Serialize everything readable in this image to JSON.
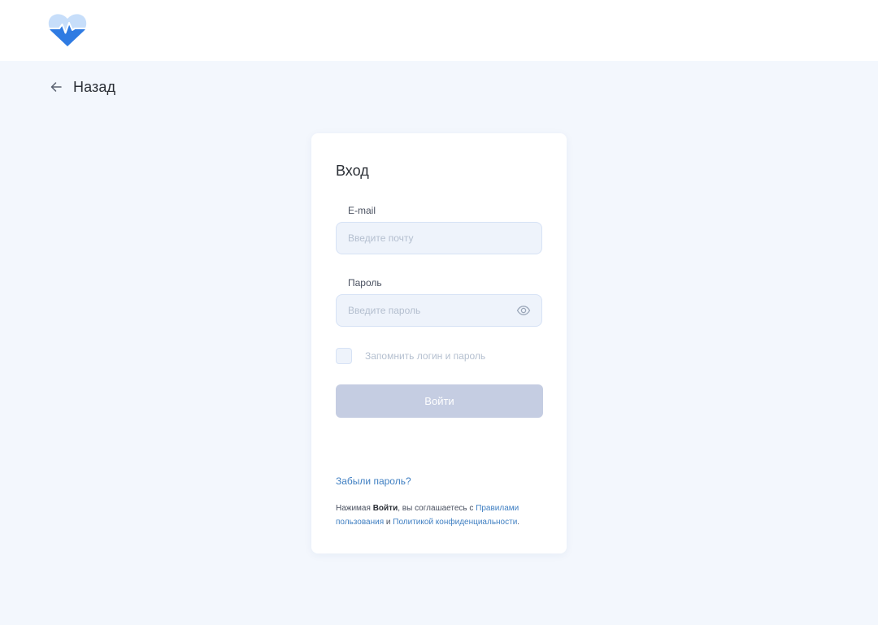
{
  "header": {
    "logo_icon": "heart-pulse-logo-icon",
    "colors": {
      "logo_light": "#c7defa",
      "logo_dark": "#2f7be2"
    }
  },
  "nav": {
    "back_icon": "arrow-left-icon",
    "back_label": "Назад"
  },
  "login": {
    "title": "Вход",
    "email": {
      "label": "E-mail",
      "placeholder": "Введите почту",
      "value": ""
    },
    "password": {
      "label": "Пароль",
      "placeholder": "Введите пароль",
      "value": "",
      "toggle_icon": "eye-icon"
    },
    "remember": {
      "label": "Запомнить логин и пароль",
      "checked": false
    },
    "submit_label": "Войти",
    "forgot_link": "Забыли пароль?",
    "terms": {
      "prefix": "Нажимая ",
      "action": "Войти",
      "middle": ", вы соглашаетесь с ",
      "rules_link": "Правилами пользования",
      "conjunction": " и ",
      "privacy_link": "Политикой конфиденциальности",
      "suffix": "."
    }
  },
  "colors": {
    "page_background": "#f3f7fd",
    "card_background": "#ffffff",
    "input_background": "#eef3fb",
    "input_border": "#d6e2f5",
    "button_disabled": "#c5cde2",
    "link": "#3f7fc2",
    "text": "#2b2f36"
  }
}
